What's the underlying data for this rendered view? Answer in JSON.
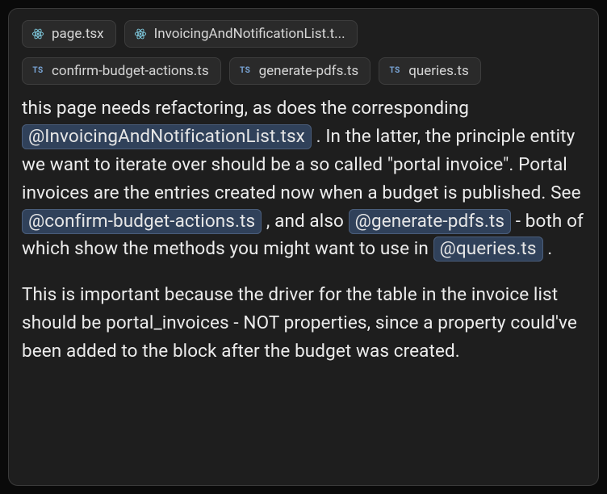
{
  "tabs": {
    "row1": [
      {
        "icon": "react",
        "label": "page.tsx"
      },
      {
        "icon": "react",
        "label": "InvoicingAndNotificationList.t..."
      }
    ],
    "row2": [
      {
        "icon": "ts",
        "label": "confirm-budget-actions.ts"
      },
      {
        "icon": "ts",
        "label": "generate-pdfs.ts"
      },
      {
        "icon": "ts",
        "label": "queries.ts"
      }
    ]
  },
  "message": {
    "p1_a": "this page needs refactoring, as does the corresponding ",
    "m1": "@InvoicingAndNotificationList.tsx",
    "p1_b": " . In the latter, the principle entity we want to iterate over should be a so called \"portal invoice\". Portal invoices are the entries created now when a budget is published. See ",
    "m2": "@confirm-budget-actions.ts",
    "p1_c": " , and also ",
    "m3": "@generate-pdfs.ts",
    "p1_d": " - both of which show the methods you might want to use in ",
    "m4": "@queries.ts",
    "p1_e": " .",
    "p2": "This is important because the driver for the table in the invoice list should be portal_invoices - NOT properties, since a property could've been added to the block after the budget was created."
  }
}
